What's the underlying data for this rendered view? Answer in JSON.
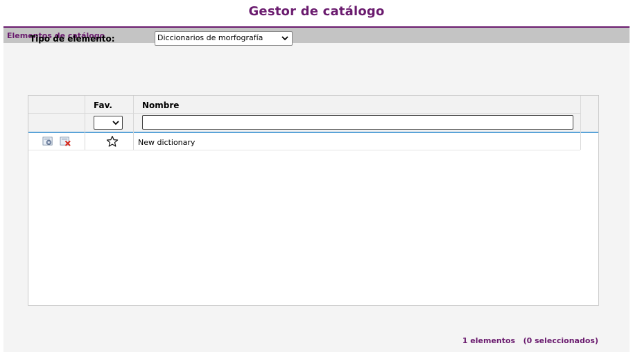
{
  "header": {
    "title": "Gestor de catálogo"
  },
  "panel": {
    "title": "Elementos de catálogo"
  },
  "type_filter": {
    "label": "Tipo de elemento:",
    "selected": "Diccionarios de morfografía"
  },
  "toolbar": {
    "left_icon": "clear-filter-icon",
    "right_icons": [
      "new-item-icon",
      "import-item-icon",
      "delete-selected-icon",
      "clear-selection-icon"
    ]
  },
  "grid": {
    "columns": {
      "fav": "Fav.",
      "name": "Nombre"
    },
    "filters": {
      "fav_selected": "",
      "name_value": ""
    },
    "rows": [
      {
        "name": "New dictionary",
        "favorite": false,
        "actions": [
          "edit-icon",
          "delete-icon"
        ]
      }
    ]
  },
  "status": {
    "count": "1 elementos",
    "selected": "(0 seleccionados)"
  },
  "colors": {
    "accent": "#6a1b6e",
    "header_bar": "#c4c4c4",
    "row_highlight": "#5aa3d8"
  }
}
